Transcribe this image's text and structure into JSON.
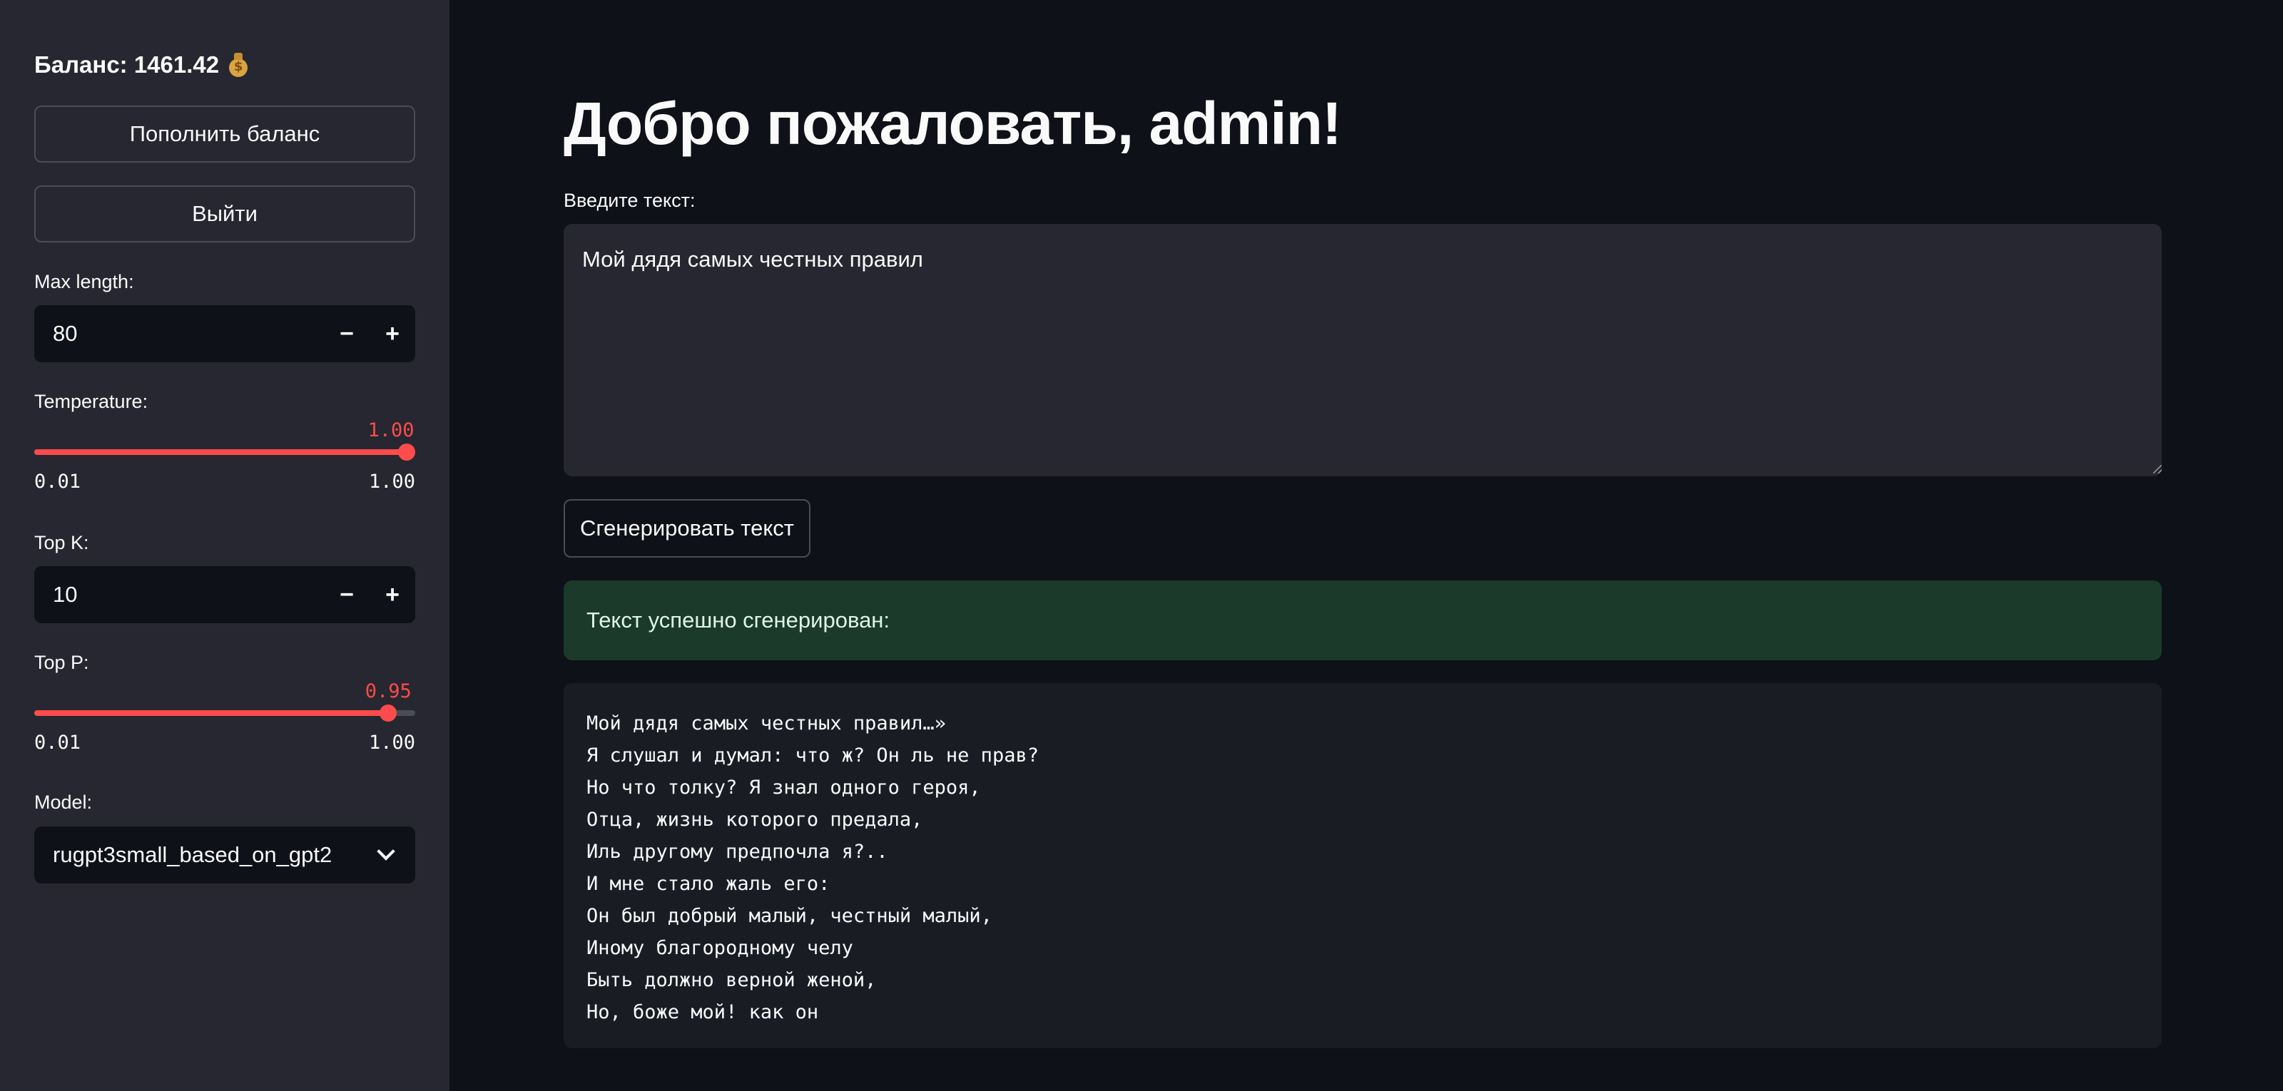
{
  "sidebar": {
    "balance_text": "Баланс: 1461.42",
    "balance_icon": "money-bag-icon",
    "topup_label": "Пополнить баланс",
    "logout_label": "Выйти",
    "max_length": {
      "label": "Max length:",
      "value": "80",
      "minus": "−",
      "plus": "+"
    },
    "temperature": {
      "label": "Temperature:",
      "current": "1.00",
      "min": "0.01",
      "max": "1.00",
      "value": 1.0
    },
    "top_k": {
      "label": "Top K:",
      "value": "10",
      "minus": "−",
      "plus": "+"
    },
    "top_p": {
      "label": "Top P:",
      "current": "0.95",
      "min": "0.01",
      "max": "1.00",
      "value": 0.95
    },
    "model": {
      "label": "Model:",
      "value": "rugpt3small_based_on_gpt2"
    }
  },
  "main": {
    "title": "Добро пожаловать, admin!",
    "input_label": "Введите текст:",
    "input_value": "Мой дядя самых честных правил",
    "generate_label": "Сгенерировать текст",
    "success_text": "Текст успешно сгенерирован:",
    "output_lines": [
      "Мой дядя самых честных правил…»",
      "Я слушал и думал: что ж? Он ль не прав?",
      "Но что толку? Я знал одного героя,",
      "Отца, жизнь которого предала,",
      "Иль другому предпочла я?..",
      "И мне стало жаль его:",
      "Он был добрый малый, честный малый,",
      "Иному благородному челу",
      "Быть должно верной женой,",
      "Но, боже мой! как он"
    ]
  },
  "colors": {
    "sidebar_bg": "#262730",
    "main_bg": "#0e1117",
    "accent": "#ff4b4b",
    "success_bg": "#1b3a29"
  }
}
